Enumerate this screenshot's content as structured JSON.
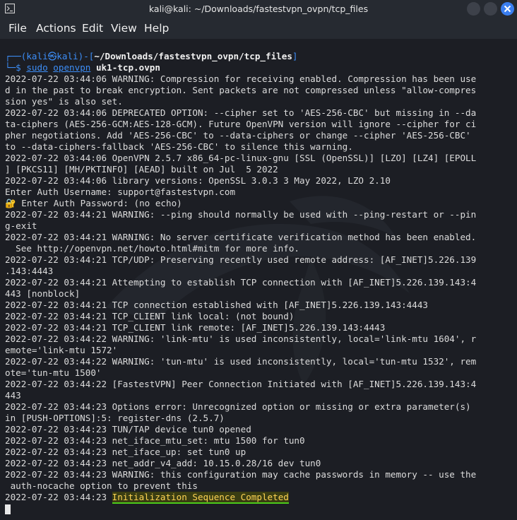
{
  "window": {
    "title": "kali@kali: ~/Downloads/fastestvpn_ovpn/tcp_files"
  },
  "menu": [
    "File",
    "Actions",
    "Edit",
    "View",
    "Help"
  ],
  "prompt": {
    "open": "┌──(",
    "user": "kali",
    "at": "㉿",
    "host": "kali",
    "mid": ")-[",
    "path": "~/Downloads/fastestvpn_ovpn/tcp_files",
    "close": "]",
    "line2_prefix": "└─$ ",
    "sudo": "sudo",
    "tool": "openvpn",
    "arg": "uk1-tcp.ovpn"
  },
  "output": [
    "2022-07-22 03:44:06 WARNING: Compression for receiving enabled. Compression has been use",
    "d in the past to break encryption. Sent packets are not compressed unless \"allow-compres",
    "sion yes\" is also set.",
    "2022-07-22 03:44:06 DEPRECATED OPTION: --cipher set to 'AES-256-CBC' but missing in --da",
    "ta-ciphers (AES-256-GCM:AES-128-GCM). Future OpenVPN version will ignore --cipher for ci",
    "pher negotiations. Add 'AES-256-CBC' to --data-ciphers or change --cipher 'AES-256-CBC'",
    "to --data-ciphers-fallback 'AES-256-CBC' to silence this warning.",
    "2022-07-22 03:44:06 OpenVPN 2.5.7 x86_64-pc-linux-gnu [SSL (OpenSSL)] [LZO] [LZ4] [EPOLL",
    "] [PKCS11] [MH/PKTINFO] [AEAD] built on Jul  5 2022",
    "2022-07-22 03:44:06 library versions: OpenSSL 3.0.3 3 May 2022, LZO 2.10",
    "Enter Auth Username: support@fastestvpn.com",
    "",
    "2022-07-22 03:44:21 WARNING: --ping should normally be used with --ping-restart or --pin",
    "g-exit",
    "2022-07-22 03:44:21 WARNING: No server certificate verification method has been enabled.",
    "  See http://openvpn.net/howto.html#mitm for more info.",
    "2022-07-22 03:44:21 TCP/UDP: Preserving recently used remote address: [AF_INET]5.226.139",
    ".143:4443",
    "2022-07-22 03:44:21 Attempting to establish TCP connection with [AF_INET]5.226.139.143:4",
    "443 [nonblock]",
    "2022-07-22 03:44:21 TCP connection established with [AF_INET]5.226.139.143:4443",
    "2022-07-22 03:44:21 TCP_CLIENT link local: (not bound)",
    "2022-07-22 03:44:21 TCP_CLIENT link remote: [AF_INET]5.226.139.143:4443",
    "2022-07-22 03:44:22 WARNING: 'link-mtu' is used inconsistently, local='link-mtu 1604', r",
    "emote='link-mtu 1572'",
    "2022-07-22 03:44:22 WARNING: 'tun-mtu' is used inconsistently, local='tun-mtu 1532', rem",
    "ote='tun-mtu 1500'",
    "2022-07-22 03:44:22 [FastestVPN] Peer Connection Initiated with [AF_INET]5.226.139.143:4",
    "443",
    "2022-07-22 03:44:23 Options error: Unrecognized option or missing or extra parameter(s)",
    "in [PUSH-OPTIONS]:5: register-dns (2.5.7)",
    "2022-07-22 03:44:23 TUN/TAP device tun0 opened",
    "2022-07-22 03:44:23 net_iface_mtu_set: mtu 1500 for tun0",
    "2022-07-22 03:44:23 net_iface_up: set tun0 up",
    "2022-07-22 03:44:23 net_addr_v4_add: 10.15.0.28/16 dev tun0",
    "2022-07-22 03:44:23 WARNING: this configuration may cache passwords in memory -- use the",
    " auth-nocache option to prevent this"
  ],
  "password_prompt": "Enter Auth Password: (no echo)",
  "final": {
    "timestamp": "2022-07-22 03:44:23 ",
    "message": "Initialization Sequence Completed"
  },
  "colors": {
    "prompt_accent": "#3d8ef7",
    "highlight_text": "#ffd454",
    "highlight_underline": "#4ccc1a",
    "close_button": "#3a7ef0"
  }
}
